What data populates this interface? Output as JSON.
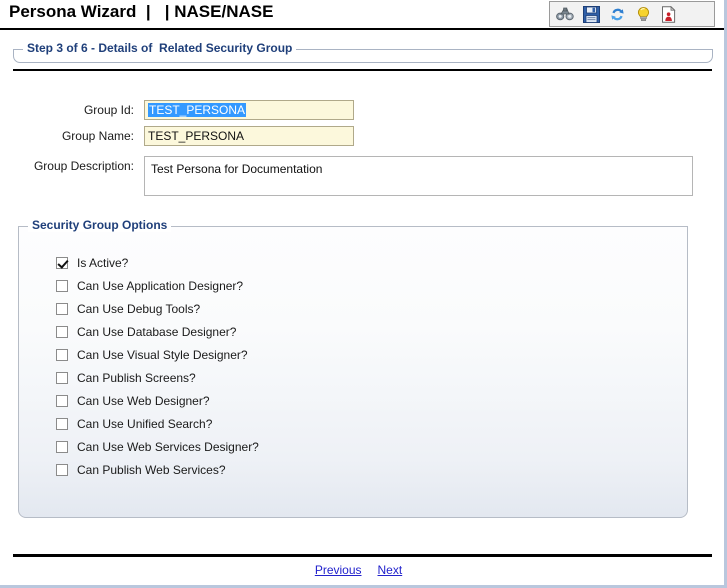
{
  "window": {
    "title": "Persona Wizard  |   | NASE/NASE"
  },
  "toolbar": {
    "items": [
      {
        "name": "binoculars-icon",
        "label": "Find"
      },
      {
        "name": "save-icon",
        "label": "Save"
      },
      {
        "name": "refresh-icon",
        "label": "Refresh"
      },
      {
        "name": "lightbulb-icon",
        "label": "Hint"
      },
      {
        "name": "document-person-icon",
        "label": "Report"
      }
    ]
  },
  "step": {
    "heading": "Step 3 of 6 - Details of  Related Security Group"
  },
  "form": {
    "group_id": {
      "label": "Group Id:",
      "value": "TEST_PERSONA",
      "selected": true
    },
    "group_name": {
      "label": "Group Name:",
      "value": "TEST_PERSONA",
      "selected": false
    },
    "group_description": {
      "label": "Group Description:",
      "value": "Test Persona for Documentation"
    }
  },
  "options": {
    "legend": "Security Group Options",
    "items": [
      {
        "label": "Is Active?",
        "checked": true
      },
      {
        "label": "Can Use Application Designer?",
        "checked": false
      },
      {
        "label": "Can Use Debug Tools?",
        "checked": false
      },
      {
        "label": "Can Use Database Designer?",
        "checked": false
      },
      {
        "label": "Can Use Visual Style Designer?",
        "checked": false
      },
      {
        "label": "Can Publish Screens?",
        "checked": false
      },
      {
        "label": "Can Use Web Designer?",
        "checked": false
      },
      {
        "label": "Can Use Unified Search?",
        "checked": false
      },
      {
        "label": "Can Use Web Services Designer?",
        "checked": false
      },
      {
        "label": "Can Publish Web Services?",
        "checked": false
      }
    ]
  },
  "footer": {
    "previous_label": "Previous",
    "next_label": "Next"
  },
  "colors": {
    "legend_blue": "#1f3f7a",
    "link_blue": "#2222cc",
    "input_yellow": "#fcf8dc",
    "selection_blue": "#3399ff"
  }
}
